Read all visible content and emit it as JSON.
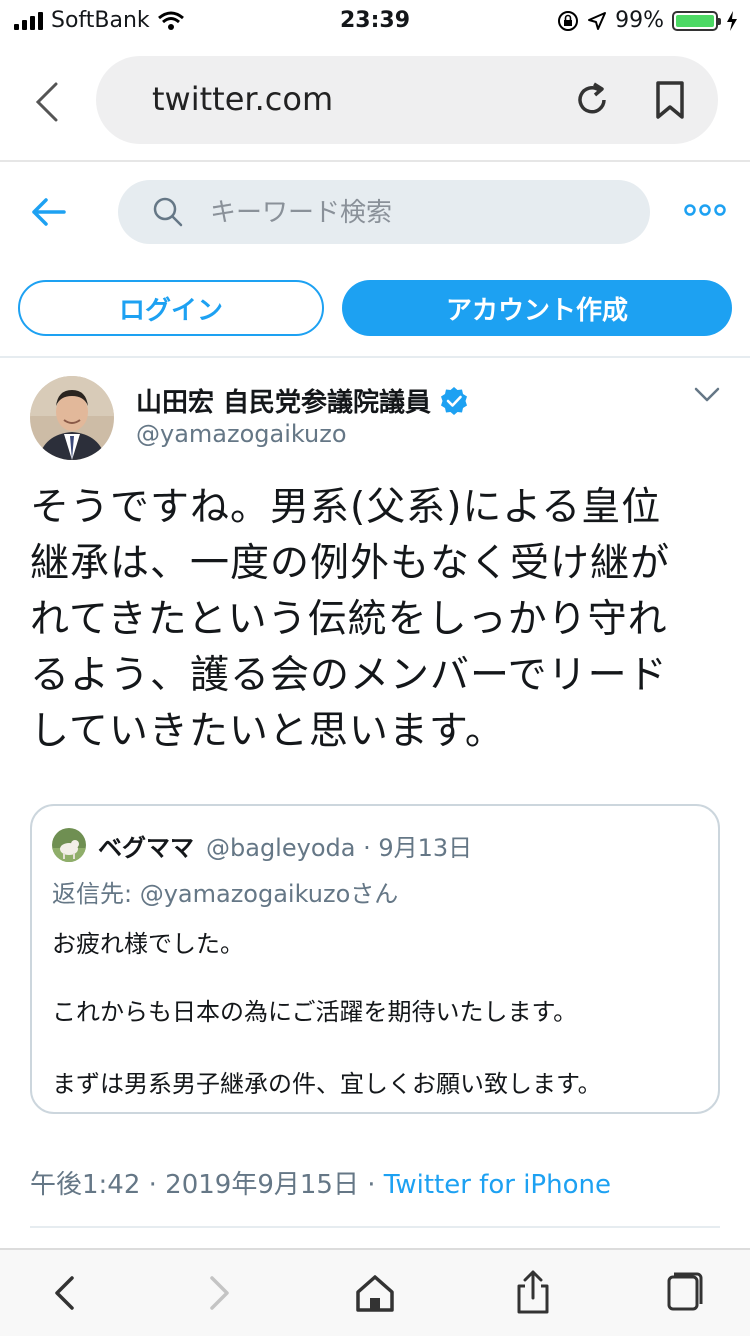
{
  "status_bar": {
    "carrier": "SoftBank",
    "time": "23:39",
    "battery": "99%",
    "battery_level": 0.99
  },
  "browser": {
    "url": "twitter.com"
  },
  "twitter": {
    "search_placeholder": "キーワード検索",
    "login_label": "ログイン",
    "create_account_label": "アカウント作成"
  },
  "tweet": {
    "author_name": "山田宏 自民党参議院議員",
    "handle": "@yamazogaikuzo",
    "lines": [
      "そうですね。男系(父系)による皇位",
      "継承は、一度の例外もなく受け継が",
      "れてきたという伝統をしっかり守れ",
      "るよう、護る会のメンバーでリード",
      "していきたいと思います。"
    ],
    "timestamp": "午後1:42 · 2019年9月15日 · ",
    "source": "Twitter for iPhone"
  },
  "quote": {
    "name": "ベグママ",
    "meta": "@bagleyoda · 9月13日",
    "reply_to": "返信先: @yamazogaikuzoさん",
    "p1": "お疲れ様でした。",
    "p2": "これからも日本の為にご活躍を期待いたします。",
    "p3": "まずは男系男子継承の件、宜しくお願い致します。"
  },
  "colors": {
    "accent": "#1da1f2",
    "secondary_text": "#657786",
    "search_bg": "#e6ecf0"
  }
}
